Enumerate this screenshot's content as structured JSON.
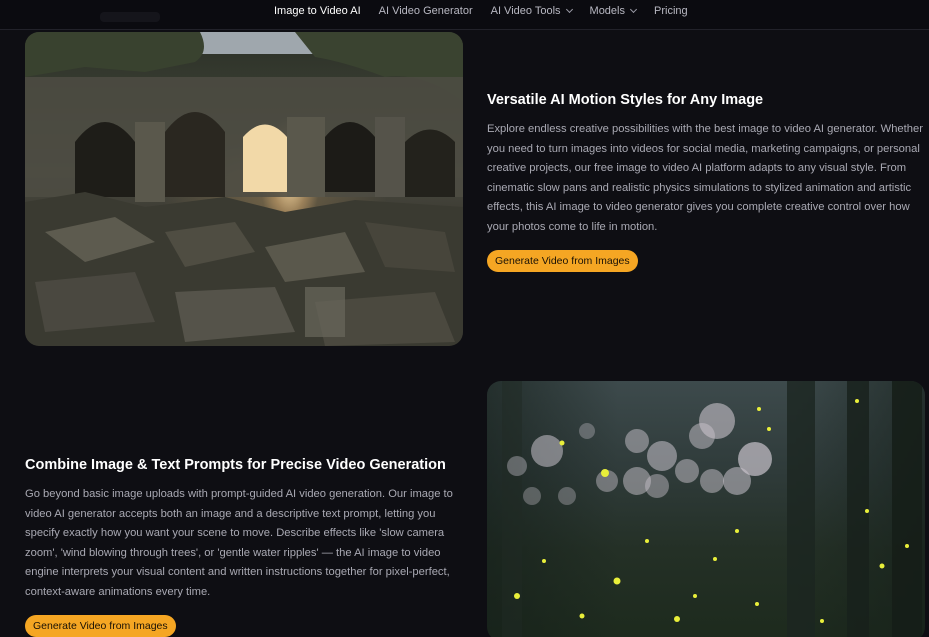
{
  "nav": {
    "links": [
      {
        "label": "Image to Video AI",
        "active": true,
        "dropdown": false
      },
      {
        "label": "AI Video Generator",
        "active": false,
        "dropdown": false
      },
      {
        "label": "AI Video Tools",
        "active": false,
        "dropdown": true
      },
      {
        "label": "Models",
        "active": false,
        "dropdown": true
      },
      {
        "label": "Pricing",
        "active": false,
        "dropdown": false
      }
    ]
  },
  "section1": {
    "heading": "Versatile AI Motion Styles for Any Image",
    "paragraph": "Explore endless creative possibilities with the best image to video AI generator. Whether you need to turn images into videos for social media, marketing campaigns, or personal creative projects, our free image to video AI platform adapts to any visual style. From cinematic slow pans and realistic physics simulations to stylized animation and artistic effects, this AI image to video generator gives you complete creative control over how your photos come to life in motion.",
    "cta_label": "Generate Video from Images"
  },
  "section2": {
    "heading": "Combine Image & Text Prompts for Precise Video Generation",
    "paragraph": "Go beyond basic image uploads with prompt-guided AI video generation. Our image to video AI generator accepts both an image and a descriptive text prompt, letting you specify exactly how you want your scene to move. Describe effects like 'slow camera zoom', 'wind blowing through trees', or 'gentle water ripples' — the AI image to video engine interprets your visual content and written instructions together for pixel-perfect, context-aware animations every time.",
    "cta_label": "Generate Video from Images"
  },
  "colors": {
    "background": "#0e0e13",
    "accent": "#f5a623",
    "heading": "#ffffff",
    "body_text": "#a9a9b3"
  }
}
